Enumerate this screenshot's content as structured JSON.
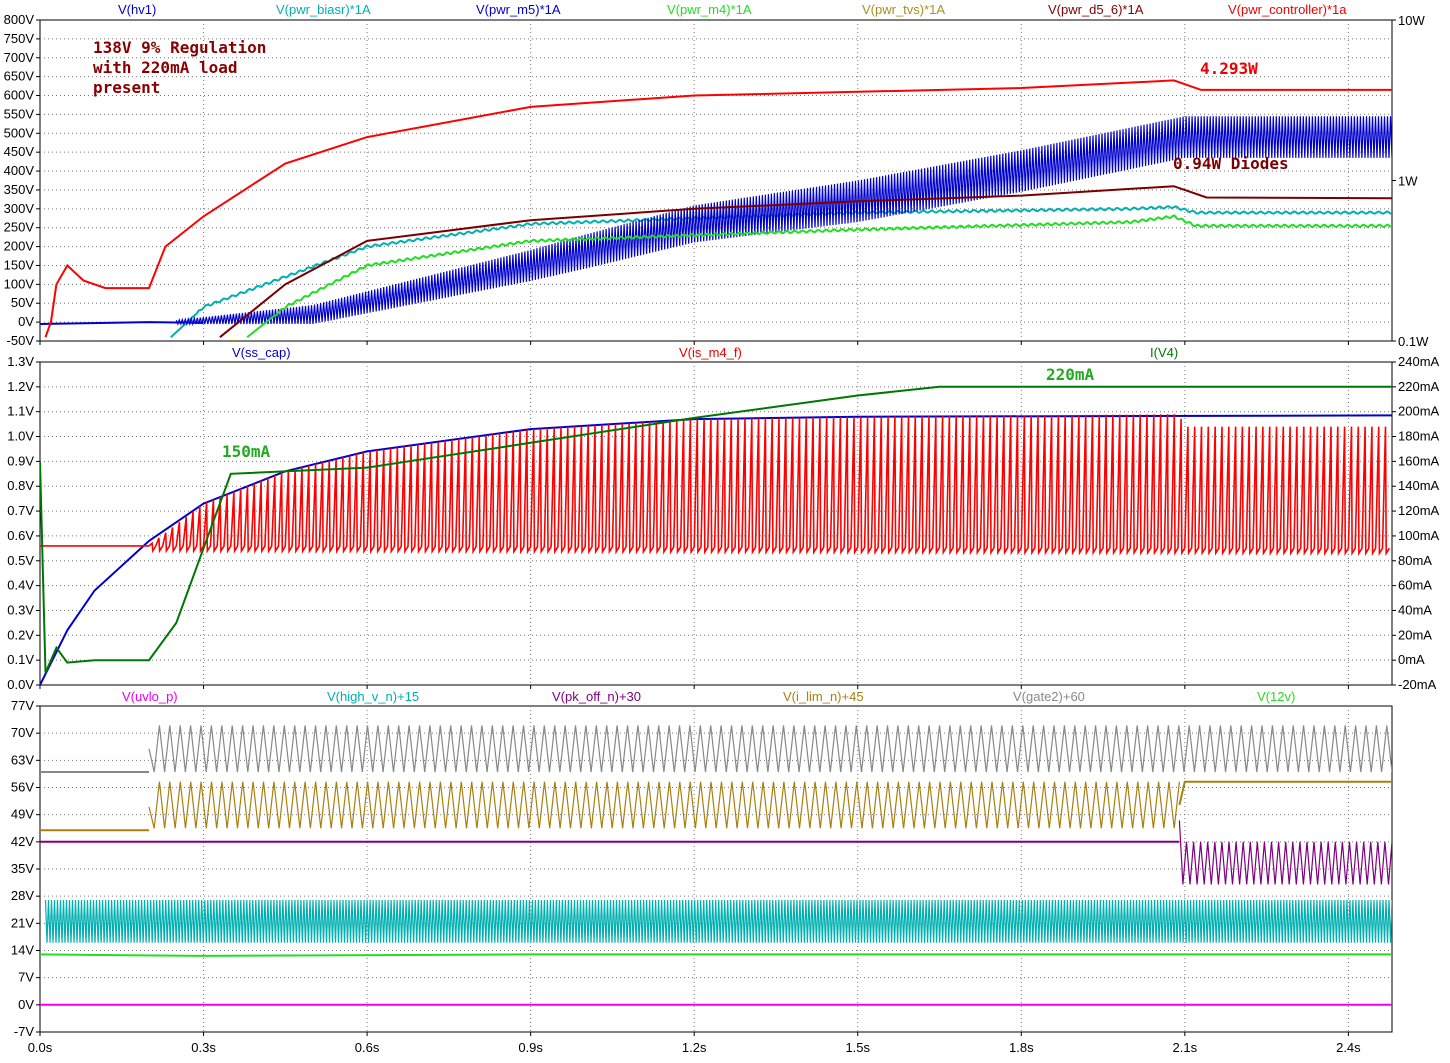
{
  "chart_data": [
    {
      "type": "line",
      "y_ticks": [
        "-50V",
        "0V",
        "50V",
        "100V",
        "150V",
        "200V",
        "250V",
        "300V",
        "350V",
        "400V",
        "450V",
        "500V",
        "550V",
        "600V",
        "650V",
        "700V",
        "750V",
        "800V"
      ],
      "y2_ticks": [
        "0.1W",
        "1W",
        "10W"
      ],
      "x_ticks": [
        "0.0s",
        "0.3s",
        "0.6s",
        "0.9s",
        "1.2s",
        "1.5s",
        "1.8s",
        "2.1s",
        "2.4s"
      ],
      "ylim": [
        -50,
        800
      ],
      "y2lim_log": [
        0.1,
        10
      ],
      "xlim": [
        0,
        2.48
      ],
      "grid": true,
      "series": [
        {
          "name": "V(hv1)",
          "color": "#0000cc",
          "style": "line",
          "points": [
            [
              0,
              -5
            ],
            [
              0.2,
              0
            ],
            [
              0.3,
              -2
            ]
          ]
        },
        {
          "name": "V(pwr_biasr)*1A",
          "color": "#00b0b0",
          "style": "wave",
          "points": [
            [
              0.24,
              -40
            ],
            [
              0.3,
              40
            ],
            [
              0.6,
              200
            ],
            [
              0.9,
              260
            ],
            [
              1.5,
              290
            ],
            [
              2.0,
              300
            ],
            [
              2.08,
              305
            ],
            [
              2.12,
              290
            ],
            [
              2.48,
              290
            ]
          ]
        },
        {
          "name": "V(pwr_m5)*1A",
          "color": "#0000cc",
          "style": "band",
          "points": [
            [
              0.25,
              0
            ],
            [
              0.5,
              20
            ],
            [
              0.9,
              150
            ],
            [
              1.2,
              260
            ],
            [
              1.5,
              320
            ],
            [
              1.8,
              400
            ],
            [
              2.1,
              490
            ],
            [
              2.48,
              490
            ]
          ],
          "amplitude": [
            [
              0.25,
              5
            ],
            [
              0.5,
              25
            ],
            [
              1.0,
              45
            ],
            [
              1.5,
              55
            ],
            [
              2.48,
              55
            ]
          ]
        },
        {
          "name": "V(pwr_m4)*1A",
          "color": "#22dd22",
          "style": "wave",
          "points": [
            [
              0.38,
              -40
            ],
            [
              0.45,
              40
            ],
            [
              0.6,
              150
            ],
            [
              0.9,
              215
            ],
            [
              1.5,
              245
            ],
            [
              2.0,
              265
            ],
            [
              2.08,
              280
            ],
            [
              2.12,
              255
            ],
            [
              2.48,
              255
            ]
          ]
        },
        {
          "name": "V(pwr_tvs)*1A",
          "color": "#a89020",
          "style": "line",
          "points": [
            [
              0.35,
              -50
            ],
            [
              0.36,
              -50
            ]
          ]
        },
        {
          "name": "V(pwr_d5_6)*1A",
          "color": "#7a0000",
          "style": "line",
          "points": [
            [
              0.33,
              -40
            ],
            [
              0.45,
              100
            ],
            [
              0.6,
              215
            ],
            [
              0.9,
              270
            ],
            [
              1.2,
              300
            ],
            [
              1.5,
              320
            ],
            [
              1.8,
              335
            ],
            [
              2.08,
              360
            ],
            [
              2.14,
              330
            ],
            [
              2.48,
              328
            ]
          ]
        },
        {
          "name": "V(pwr_controller)*1a",
          "color": "#ff0000",
          "style": "line",
          "points": [
            [
              0.01,
              -40
            ],
            [
              0.02,
              0
            ],
            [
              0.03,
              100
            ],
            [
              0.05,
              150
            ],
            [
              0.08,
              110
            ],
            [
              0.12,
              90
            ],
            [
              0.2,
              90
            ],
            [
              0.23,
              200
            ],
            [
              0.3,
              280
            ],
            [
              0.45,
              420
            ],
            [
              0.6,
              490
            ],
            [
              0.9,
              570
            ],
            [
              1.2,
              600
            ],
            [
              1.5,
              610
            ],
            [
              1.8,
              620
            ],
            [
              2.08,
              640
            ],
            [
              2.13,
              615
            ],
            [
              2.48,
              615
            ]
          ]
        }
      ],
      "annotations": [
        {
          "text": "138V 9% Regulation",
          "color": "#880000"
        },
        {
          "text": "with 220mA load",
          "color": "#880000"
        },
        {
          "text": "present",
          "color": "#880000"
        },
        {
          "text": "4.293W",
          "color": "#ee0000"
        },
        {
          "text": "0.94W Diodes",
          "color": "#7a0000"
        }
      ]
    },
    {
      "type": "line",
      "y_ticks": [
        "0.0V",
        "0.1V",
        "0.2V",
        "0.3V",
        "0.4V",
        "0.5V",
        "0.6V",
        "0.7V",
        "0.8V",
        "0.9V",
        "1.0V",
        "1.1V",
        "1.2V",
        "1.3V"
      ],
      "y2_ticks": [
        "-20mA",
        "0mA",
        "20mA",
        "40mA",
        "60mA",
        "80mA",
        "100mA",
        "120mA",
        "140mA",
        "160mA",
        "180mA",
        "200mA",
        "220mA",
        "240mA"
      ],
      "x_ticks": [
        "0.0s",
        "0.3s",
        "0.6s",
        "0.9s",
        "1.2s",
        "1.5s",
        "1.8s",
        "2.1s",
        "2.4s"
      ],
      "ylim": [
        0,
        1.3
      ],
      "y2lim": [
        -20,
        240
      ],
      "xlim": [
        0,
        2.48
      ],
      "grid": true,
      "series": [
        {
          "name": "V(ss_cap)",
          "color": "#0000cc",
          "style": "line",
          "points": [
            [
              0,
              0
            ],
            [
              0.05,
              0.22
            ],
            [
              0.1,
              0.38
            ],
            [
              0.2,
              0.58
            ],
            [
              0.3,
              0.73
            ],
            [
              0.45,
              0.86
            ],
            [
              0.6,
              0.94
            ],
            [
              0.9,
              1.03
            ],
            [
              1.2,
              1.07
            ],
            [
              1.5,
              1.08
            ],
            [
              2.48,
              1.085
            ]
          ]
        },
        {
          "name": "V(is_m4_f)",
          "color": "#ff0000",
          "style": "pulse",
          "points": [
            [
              0,
              0.56
            ],
            [
              0.2,
              0.56
            ],
            [
              2.48,
              0.55
            ]
          ],
          "peaks": [
            [
              0.2,
              0.56
            ],
            [
              0.3,
              0.73
            ],
            [
              0.45,
              0.86
            ],
            [
              0.6,
              0.94
            ],
            [
              0.9,
              1.03
            ],
            [
              1.2,
              1.07
            ],
            [
              1.5,
              1.08
            ],
            [
              2.09,
              1.09
            ],
            [
              2.1,
              1.04
            ],
            [
              2.48,
              1.04
            ]
          ]
        },
        {
          "name": "I(V4)",
          "color": "#007700",
          "style": "line",
          "axis": "y2",
          "points": [
            [
              0,
              160
            ],
            [
              0.01,
              -10
            ],
            [
              0.03,
              10
            ],
            [
              0.05,
              -2
            ],
            [
              0.1,
              0
            ],
            [
              0.2,
              0
            ],
            [
              0.25,
              30
            ],
            [
              0.3,
              90
            ],
            [
              0.35,
              150
            ],
            [
              0.6,
              155
            ],
            [
              0.9,
              175
            ],
            [
              1.2,
              195
            ],
            [
              1.5,
              213
            ],
            [
              1.65,
              220
            ],
            [
              2.48,
              220
            ]
          ]
        }
      ],
      "annotations": [
        {
          "text": "150mA",
          "color": "#22aa22"
        },
        {
          "text": "220mA",
          "color": "#22aa22"
        }
      ]
    },
    {
      "type": "line",
      "y_ticks": [
        "-7V",
        "0V",
        "7V",
        "14V",
        "21V",
        "28V",
        "35V",
        "42V",
        "49V",
        "56V",
        "63V",
        "70V",
        "77V"
      ],
      "x_ticks": [
        "0.0s",
        "0.3s",
        "0.6s",
        "0.9s",
        "1.2s",
        "1.5s",
        "1.8s",
        "2.1s",
        "2.4s"
      ],
      "ylim": [
        -7,
        77
      ],
      "xlim": [
        0,
        2.48
      ],
      "grid": true,
      "series": [
        {
          "name": "V(uvlo_p)",
          "color": "#ee00ee",
          "style": "line",
          "points": [
            [
              0,
              0
            ],
            [
              2.48,
              0
            ]
          ]
        },
        {
          "name": "V(high_v_n)+15",
          "color": "#00b0b0",
          "style": "band",
          "points": [
            [
              0.01,
              21.5
            ],
            [
              2.48,
              21.5
            ]
          ],
          "amplitude": [
            [
              0.01,
              5.5
            ],
            [
              2.48,
              5.5
            ]
          ]
        },
        {
          "name": "V(pk_off_n)+30",
          "color": "#800080",
          "style": "line",
          "points": [
            [
              0,
              42
            ],
            [
              2.09,
              42
            ],
            [
              2.09,
              36.5
            ],
            [
              2.48,
              36.5
            ]
          ],
          "band_from": 2.09,
          "amplitude": 5.5
        },
        {
          "name": "V(i_lim_n)+45",
          "color": "#a88010",
          "style": "line",
          "points": [
            [
              0,
              45
            ],
            [
              0.2,
              45
            ],
            [
              0.2,
              51.5
            ],
            [
              2.09,
              51.5
            ],
            [
              2.1,
              57.5
            ],
            [
              2.48,
              57.5
            ]
          ],
          "band_from": 0.2,
          "band_to": 2.09,
          "amplitude": 6
        },
        {
          "name": "V(gate2)+60",
          "color": "#888888",
          "style": "line",
          "points": [
            [
              0,
              60
            ],
            [
              0.2,
              60
            ],
            [
              0.2,
              66
            ],
            [
              2.48,
              66
            ]
          ],
          "band_from": 0.2,
          "amplitude": 6
        },
        {
          "name": "V(12v)",
          "color": "#22dd22",
          "style": "line",
          "points": [
            [
              0,
              13
            ],
            [
              0.3,
              12.6
            ],
            [
              0.9,
              13
            ],
            [
              2.48,
              13
            ]
          ]
        }
      ]
    }
  ]
}
